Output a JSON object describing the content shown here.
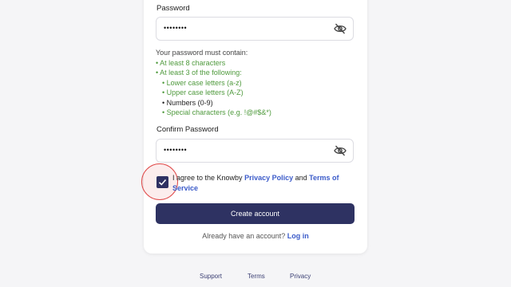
{
  "password": {
    "label": "Password",
    "value": "••••••••",
    "toggle_icon": "eye-slash-icon"
  },
  "requirements": {
    "intro": "Your password must contain:",
    "items": [
      {
        "text": "• At least 8 characters",
        "met": true
      },
      {
        "text": "• At least 3 of the following:",
        "met": true
      },
      {
        "text": "• Lower case letters (a-z)",
        "met": true,
        "sub": true
      },
      {
        "text": "• Upper case letters (A-Z)",
        "met": true,
        "sub": true
      },
      {
        "text": "• Numbers (0-9)",
        "met": false,
        "sub": true
      },
      {
        "text": "• Special characters (e.g. !@#$&*)",
        "met": true,
        "sub": true
      }
    ]
  },
  "confirm": {
    "label": "Confirm Password",
    "value": "••••••••",
    "toggle_icon": "eye-slash-icon"
  },
  "agree": {
    "checked": true,
    "prefix": "I agree to the Knowby ",
    "privacy_link": "Privacy Policy",
    "middle": " and ",
    "terms_link": "Terms of Service"
  },
  "create_button": "Create account",
  "login_prompt": {
    "text": "Already have an account? ",
    "link": "Log in"
  },
  "footer": {
    "support": "Support",
    "terms": "Terms",
    "privacy": "Privacy"
  },
  "colors": {
    "primary": "#2e3262",
    "link": "#3b5bc9",
    "valid": "#4f9a3d"
  }
}
